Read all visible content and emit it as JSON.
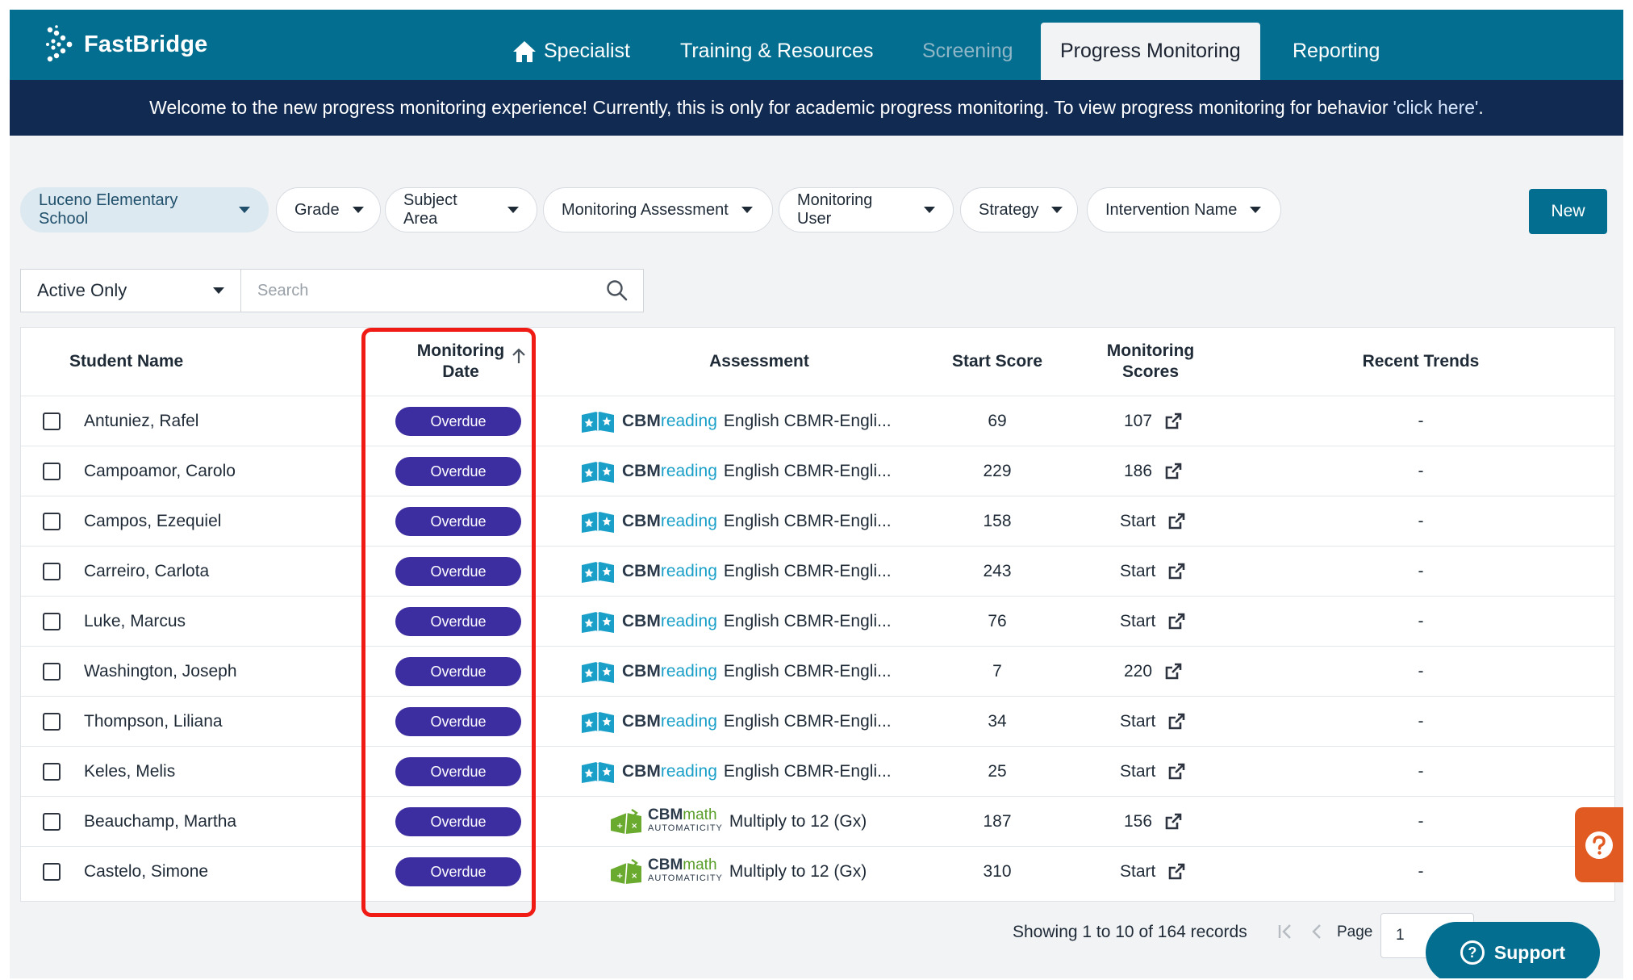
{
  "app": {
    "name": "FastBridge"
  },
  "nav": {
    "items": [
      {
        "label": "Specialist",
        "icon": "home-icon"
      },
      {
        "label": "Training & Resources"
      },
      {
        "label": "Screening",
        "state": "disabled"
      },
      {
        "label": "Progress Monitoring",
        "state": "active"
      },
      {
        "label": "Reporting"
      }
    ]
  },
  "banner": {
    "text": "Welcome to the new progress monitoring experience! Currently, this is only for academic progress monitoring. To view progress monitoring for behavior",
    "link": "'click here'",
    "suffix": "."
  },
  "filters": {
    "school": "Luceno Elementary School",
    "grade": "Grade",
    "subject_area": "Subject Area",
    "monitoring_assessment": "Monitoring Assessment",
    "monitoring_user": "Monitoring User",
    "strategy": "Strategy",
    "intervention_name": "Intervention Name",
    "new_button": "New"
  },
  "list_controls": {
    "status_select": "Active Only",
    "search_placeholder": "Search"
  },
  "table": {
    "columns": {
      "student_name": "Student Name",
      "monitoring_date_1": "Monitoring",
      "monitoring_date_2": "Date",
      "assessment": "Assessment",
      "start_score": "Start Score",
      "monitoring_scores_1": "Monitoring",
      "monitoring_scores_2": "Scores",
      "recent_trends": "Recent Trends"
    },
    "sort": {
      "column": "Monitoring Date",
      "direction": "ascending"
    },
    "rows": [
      {
        "name": "Antuniez, Rafel",
        "status": "Overdue",
        "product": "CBMreading",
        "product_a": "CBM",
        "product_b": "reading",
        "product_sub": "",
        "assessment": "English CBMR-Engli...",
        "start_score": "69",
        "monitoring_score": "107",
        "trend": "-"
      },
      {
        "name": "Campoamor, Carolo",
        "status": "Overdue",
        "product": "CBMreading",
        "product_a": "CBM",
        "product_b": "reading",
        "product_sub": "",
        "assessment": "English CBMR-Engli...",
        "start_score": "229",
        "monitoring_score": "186",
        "trend": "-"
      },
      {
        "name": "Campos, Ezequiel",
        "status": "Overdue",
        "product": "CBMreading",
        "product_a": "CBM",
        "product_b": "reading",
        "product_sub": "",
        "assessment": "English CBMR-Engli...",
        "start_score": "158",
        "monitoring_score": "Start",
        "trend": "-"
      },
      {
        "name": "Carreiro, Carlota",
        "status": "Overdue",
        "product": "CBMreading",
        "product_a": "CBM",
        "product_b": "reading",
        "product_sub": "",
        "assessment": "English CBMR-Engli...",
        "start_score": "243",
        "monitoring_score": "Start",
        "trend": "-"
      },
      {
        "name": "Luke, Marcus",
        "status": "Overdue",
        "product": "CBMreading",
        "product_a": "CBM",
        "product_b": "reading",
        "product_sub": "",
        "assessment": "English CBMR-Engli...",
        "start_score": "76",
        "monitoring_score": "Start",
        "trend": "-"
      },
      {
        "name": "Washington, Joseph",
        "status": "Overdue",
        "product": "CBMreading",
        "product_a": "CBM",
        "product_b": "reading",
        "product_sub": "",
        "assessment": "English CBMR-Engli...",
        "start_score": "7",
        "monitoring_score": "220",
        "trend": "-"
      },
      {
        "name": "Thompson, Liliana",
        "status": "Overdue",
        "product": "CBMreading",
        "product_a": "CBM",
        "product_b": "reading",
        "product_sub": "",
        "assessment": "English CBMR-Engli...",
        "start_score": "34",
        "monitoring_score": "Start",
        "trend": "-"
      },
      {
        "name": "Keles, Melis",
        "status": "Overdue",
        "product": "CBMreading",
        "product_a": "CBM",
        "product_b": "reading",
        "product_sub": "",
        "assessment": "English CBMR-Engli...",
        "start_score": "25",
        "monitoring_score": "Start",
        "trend": "-"
      },
      {
        "name": "Beauchamp, Martha",
        "status": "Overdue",
        "product": "CBMmath",
        "product_a": "CBM",
        "product_b": "math",
        "product_sub": "AUTOMATICITY",
        "assessment": "Multiply to 12 (Gx)",
        "start_score": "187",
        "monitoring_score": "156",
        "trend": "-"
      },
      {
        "name": "Castelo, Simone",
        "status": "Overdue",
        "product": "CBMmath",
        "product_a": "CBM",
        "product_b": "math",
        "product_sub": "AUTOMATICITY",
        "assessment": "Multiply to 12 (Gx)",
        "start_score": "310",
        "monitoring_score": "Start",
        "trend": "-"
      }
    ]
  },
  "pagination": {
    "summary": "Showing 1 to 10 of 164 records",
    "page_label": "Page",
    "page_value": "1"
  },
  "support": {
    "label": "Support"
  },
  "colors": {
    "nav_bg": "#036e8f",
    "banner_bg": "#112a52",
    "overdue_badge": "#3c2ea0",
    "highlight": "#f01b14",
    "help_tab": "#e15a22"
  }
}
